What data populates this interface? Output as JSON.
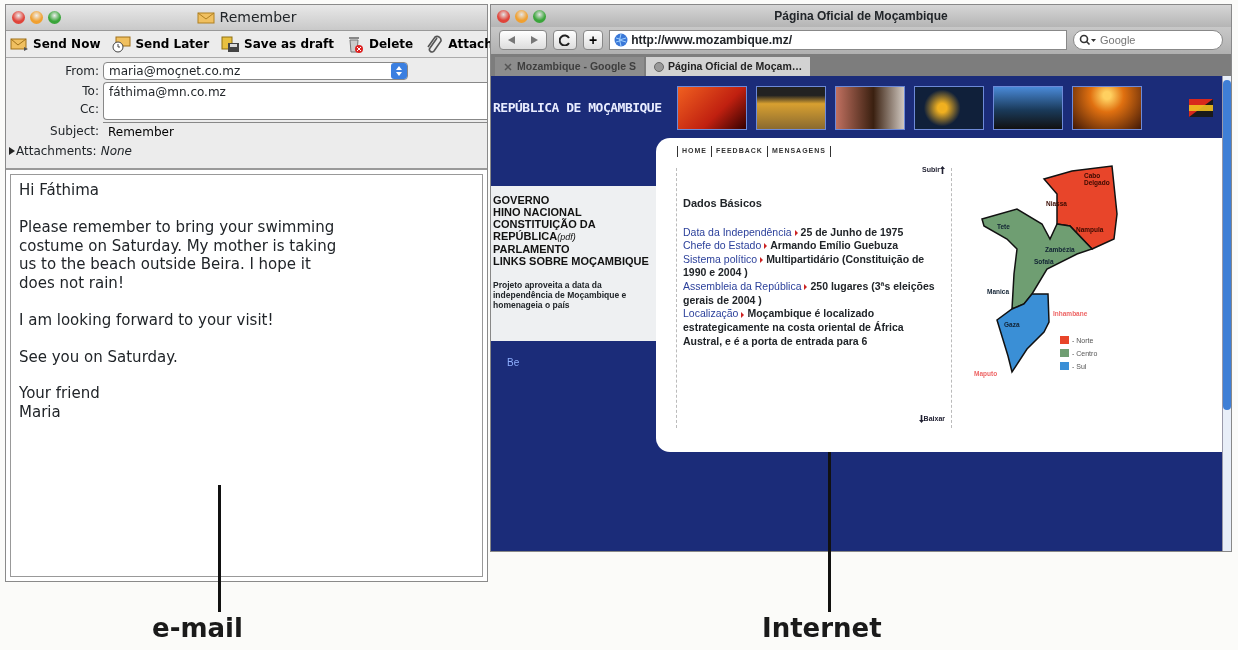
{
  "email_window": {
    "title": "Remember",
    "toolbar": [
      {
        "label": "Send Now"
      },
      {
        "label": "Send Later"
      },
      {
        "label": "Save as draft"
      },
      {
        "label": "Delete"
      },
      {
        "label": "Attach"
      }
    ],
    "from": {
      "label": "From:",
      "value": "maria@moçnet.co.mz"
    },
    "to": {
      "label": "To:",
      "value": "fáthima@mn.co.mz"
    },
    "cc": {
      "label": "Cc:"
    },
    "subject": {
      "label": "Subject:",
      "value": "Remember"
    },
    "attachments": {
      "label": "Attachments:",
      "value": "None",
      "expanded": false
    },
    "body": [
      [
        "Hi Fáthima"
      ],
      [
        "Please remember to bring your swimming",
        "costume on Saturday. My mother is taking",
        "us to the beach outside Beira. I hope it",
        "does not rain!"
      ],
      [
        "I am looking forward to your visit!"
      ],
      [
        "See you on Saturday."
      ],
      [
        "Your friend",
        "Maria"
      ]
    ]
  },
  "browser_window": {
    "title": "Página Oficial de Moçambique",
    "plus_button": "+",
    "url": "http://www.mozambique.mz/",
    "search": {
      "placeholder": "Google"
    },
    "tabs": [
      {
        "label": "Mozambique - Google S",
        "selected": false
      },
      {
        "label": "Página Oficial de Moçam…",
        "selected": true
      }
    ],
    "page": {
      "site_title": "REPÚBLICA DE MOÇAMBIQUE",
      "menu": [
        {
          "label": "GOVERNO"
        },
        {
          "label": "HINO NACIONAL"
        },
        {
          "label": "CONSTITUIÇÃO DA REPÚBLICA",
          "note": "(pdf)"
        },
        {
          "label": "PARLAMENTO"
        },
        {
          "label": "LINKS SOBRE MOÇAMBIQUE"
        }
      ],
      "news": "Projeto aproveita a data da independência de Moçambique e homenageia o país",
      "sidebar_link": "Be",
      "nav": [
        "HOME",
        "FEEDBACK",
        "MENSAGENS"
      ],
      "up_link": "Subir",
      "heading": "Dados Básicos",
      "facts": [
        {
          "label": "Data da Independência",
          "value": "25 de Junho de 1975"
        },
        {
          "label": "Chefe do Estado",
          "value": "Armando Emílio Guebuza"
        },
        {
          "label": "Sistema político",
          "value": "Multipartidário (Constituição de 1990 e 2004 )"
        },
        {
          "label": "Assembleia da República",
          "value": "250 lugares (3ªs eleições gerais de 2004 )"
        },
        {
          "label": "Localização",
          "value": "Moçambique é localizado estrategicamente na costa oriental de África Austral, e é a porta de entrada para 6"
        }
      ],
      "down_link": "Baixar",
      "map": {
        "provinces": [
          "Niassa",
          "Cabo Delgado",
          "Nampula",
          "Tete",
          "Zambézia",
          "Sofala",
          "Manica",
          "Inhambane",
          "Gaza",
          "Maputo"
        ],
        "legend": [
          {
            "label": "- Norte",
            "color": "#e8452a"
          },
          {
            "label": "- Centro",
            "color": "#6f9e72"
          },
          {
            "label": "- Sul",
            "color": "#3a8fd6"
          }
        ]
      }
    }
  },
  "captions": [
    "e-mail",
    "Internet"
  ]
}
